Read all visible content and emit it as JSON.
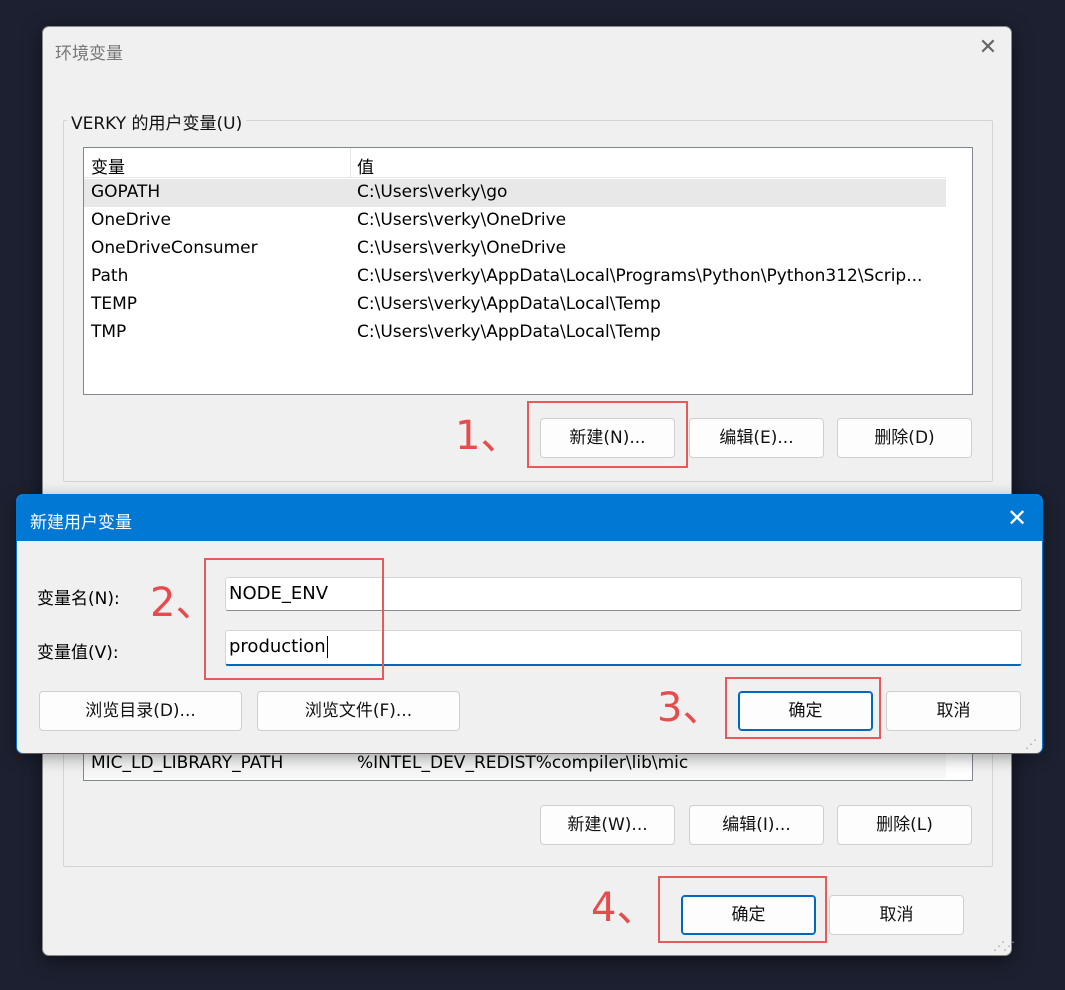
{
  "main_window": {
    "title": "环境变量",
    "user_vars_group_title": "VERKY 的用户变量(U)",
    "columns": {
      "name": "变量",
      "value": "值"
    },
    "user_vars": [
      {
        "name": "GOPATH",
        "value": "C:\\Users\\verky\\go"
      },
      {
        "name": "OneDrive",
        "value": "C:\\Users\\verky\\OneDrive"
      },
      {
        "name": "OneDriveConsumer",
        "value": "C:\\Users\\verky\\OneDrive"
      },
      {
        "name": "Path",
        "value": "C:\\Users\\verky\\AppData\\Local\\Programs\\Python\\Python312\\Scrip..."
      },
      {
        "name": "TEMP",
        "value": "C:\\Users\\verky\\AppData\\Local\\Temp"
      },
      {
        "name": "TMP",
        "value": "C:\\Users\\verky\\AppData\\Local\\Temp"
      }
    ],
    "user_buttons": {
      "new": "新建(N)...",
      "edit": "编辑(E)...",
      "delete": "删除(D)"
    },
    "system_vars_visible": [
      {
        "name": "MIC_LD_LIBRARY_PATH",
        "value": "%INTEL_DEV_REDIST%compiler\\lib\\mic"
      }
    ],
    "system_buttons": {
      "new": "新建(W)...",
      "edit": "编辑(I)...",
      "delete": "删除(L)"
    },
    "ok": "确定",
    "cancel": "取消"
  },
  "dialog": {
    "title": "新建用户变量",
    "name_label": "变量名(N):",
    "value_label": "变量值(V):",
    "name_value": "NODE_ENV",
    "value_value": "production",
    "browse_dir": "浏览目录(D)...",
    "browse_file": "浏览文件(F)...",
    "ok": "确定",
    "cancel": "取消"
  },
  "annotations": [
    "1、",
    "2、",
    "3、",
    "4、"
  ],
  "colors": {
    "accent": "#0078d4",
    "annotation": "#e84b4b"
  }
}
